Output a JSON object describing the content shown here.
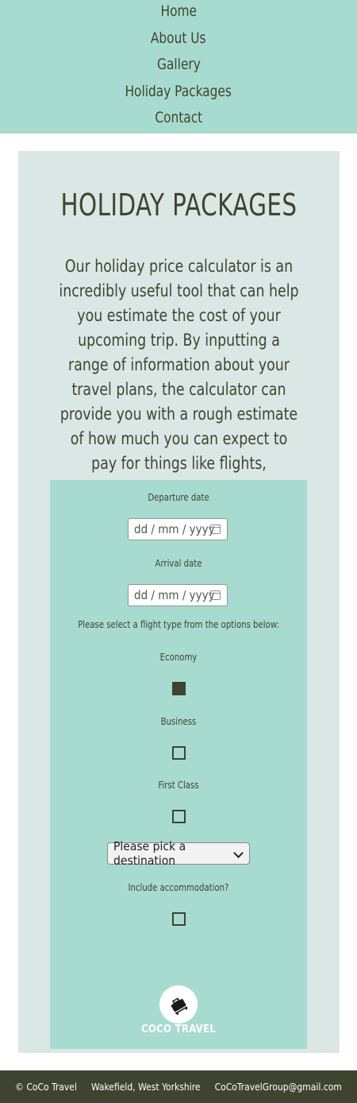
{
  "nav": {
    "items": [
      "Home",
      "About Us",
      "Gallery",
      "Holiday Packages",
      "Contact"
    ]
  },
  "main": {
    "title": "HOLIDAY PACKAGES",
    "intro": "Our holiday price calculator is an incredibly useful tool that can help you estimate the cost of your upcoming trip. By inputting a range of information about your travel plans, the calculator can provide you with a rough estimate of how much you can expect to pay for things like flights, accommodation, and other expenses."
  },
  "form": {
    "departure_label": "Departure date",
    "departure_placeholder": "dd / mm / yyyy",
    "arrival_label": "Arrival date",
    "arrival_placeholder": "dd / mm / yyyy",
    "flight_prompt": "Please select a flight type from the options below:",
    "options": [
      {
        "label": "Economy",
        "checked": true
      },
      {
        "label": "Business",
        "checked": false
      },
      {
        "label": "First Class",
        "checked": false
      }
    ],
    "destination_select": "Please pick a destination",
    "accommodation_label": "Include accommodation?",
    "accommodation_checked": false
  },
  "logo": {
    "text": "COCO TRAVEL",
    "icon": "suitcase-icon"
  },
  "footer": {
    "copyright": "© CoCo Travel",
    "location": "Wakefield, West Yorkshire",
    "email": "CoCoTravelGroup@gmail.com"
  },
  "colors": {
    "accent": "#a8dbcf",
    "panel": "#dbe7e4",
    "dark": "#3e4430"
  }
}
